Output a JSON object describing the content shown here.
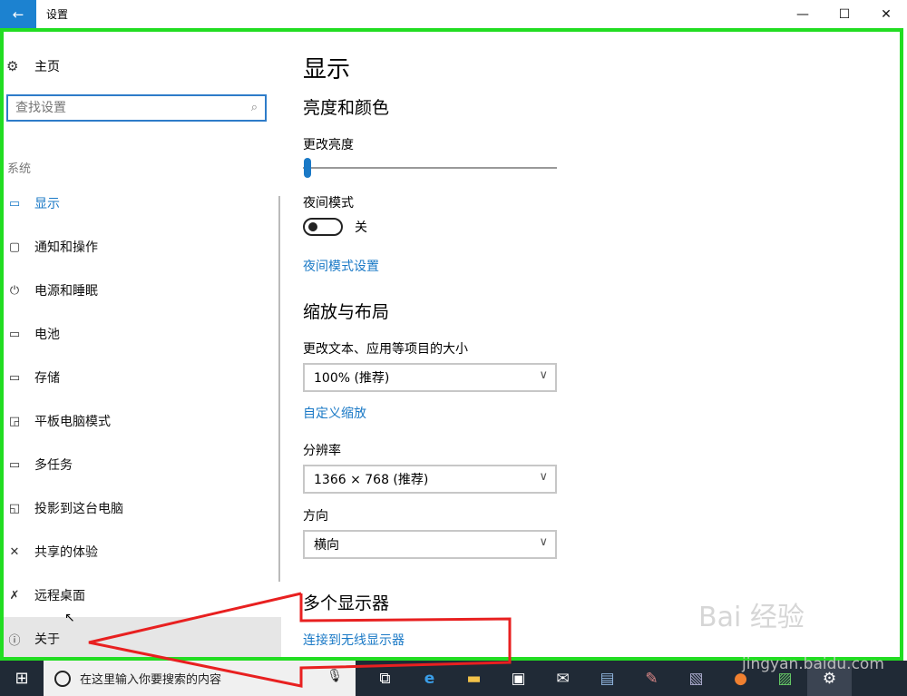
{
  "window": {
    "title": "设置",
    "back_icon": "←",
    "minimize_icon": "—",
    "maximize_icon": "☐",
    "close_icon": "✕"
  },
  "sidebar": {
    "home_icon": "⚙",
    "home_label": "主页",
    "search_placeholder": "查找设置",
    "search_icon": "⌕",
    "section_label": "系统",
    "items": [
      {
        "icon": "▭",
        "label": "显示",
        "active": true
      },
      {
        "icon": "▢",
        "label": "通知和操作"
      },
      {
        "icon": "⏻",
        "label": "电源和睡眠"
      },
      {
        "icon": "▭",
        "label": "电池"
      },
      {
        "icon": "▭",
        "label": "存储"
      },
      {
        "icon": "◲",
        "label": "平板电脑模式"
      },
      {
        "icon": "▭",
        "label": "多任务"
      },
      {
        "icon": "◱",
        "label": "投影到这台电脑"
      },
      {
        "icon": "✕",
        "label": "共享的体验"
      },
      {
        "icon": "✗",
        "label": "远程桌面"
      },
      {
        "icon": "ⓘ",
        "label": "关于"
      }
    ]
  },
  "main": {
    "page_title": "显示",
    "brightness_section": "亮度和颜色",
    "brightness_label": "更改亮度",
    "brightness_value": 0,
    "night_mode_label": "夜间模式",
    "night_mode_state": "关",
    "night_mode_link": "夜间模式设置",
    "scale_section": "缩放与布局",
    "scale_label": "更改文本、应用等项目的大小",
    "scale_value": "100% (推荐)",
    "custom_scale_link": "自定义缩放",
    "resolution_label": "分辨率",
    "resolution_value": "1366 × 768 (推荐)",
    "orientation_label": "方向",
    "orientation_value": "横向",
    "multi_display_section": "多个显示器",
    "wireless_link": "连接到无线显示器",
    "chevron_icon": "∨"
  },
  "taskbar": {
    "start_icon": "⊞",
    "search_placeholder": "在这里输入你要搜索的内容",
    "mic_icon": "🎤",
    "icons": [
      "task-view",
      "edge",
      "file-explorer",
      "store",
      "mail",
      "app-1",
      "app-2",
      "app-3",
      "app-4",
      "app-5",
      "settings"
    ]
  },
  "watermark": {
    "brand": "Bai 经验",
    "url": "jingyan.baidu.com"
  },
  "colors": {
    "accent": "#1a79c6",
    "frame_green": "#22dd22",
    "annotation_red": "#e82020",
    "taskbar": "#202a36"
  }
}
